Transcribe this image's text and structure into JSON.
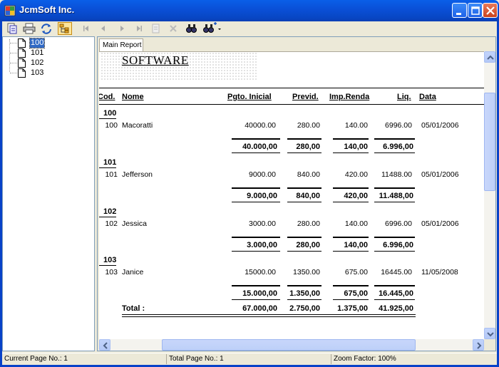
{
  "window": {
    "title": "JcmSoft Inc."
  },
  "toolbar": {
    "icons": [
      "export-icon",
      "print-icon",
      "refresh-icon",
      "group-tree-icon",
      "first-page-icon",
      "prev-page-icon",
      "next-page-icon",
      "last-page-icon",
      "goto-page-icon",
      "stop-icon",
      "search-icon",
      "zoom-icon"
    ]
  },
  "tree": {
    "items": [
      {
        "label": "100",
        "selected": true
      },
      {
        "label": "101",
        "selected": false
      },
      {
        "label": "102",
        "selected": false
      },
      {
        "label": "103",
        "selected": false
      }
    ]
  },
  "report": {
    "tab_label": "Main Report",
    "title": "SOFTWARE",
    "columns": {
      "cod": "Cod.",
      "nome": "Nome",
      "pgto": "Pgto. Inicial",
      "previd": "Previd.",
      "imp": "Imp.Renda",
      "liq": "Liq.",
      "data": "Data"
    },
    "groups": [
      {
        "group": "100",
        "row": {
          "cod": "100",
          "nome": "Macoratti",
          "pgto": "40000.00",
          "previd": "280.00",
          "imp": "140.00",
          "liq": "6996.00",
          "data": "05/01/2006"
        },
        "subtotal": {
          "pgto": "40.000,00",
          "previd": "280,00",
          "imp": "140,00",
          "liq": "6.996,00"
        }
      },
      {
        "group": "101",
        "row": {
          "cod": "101",
          "nome": "Jefferson",
          "pgto": "9000.00",
          "previd": "840.00",
          "imp": "420.00",
          "liq": "11488.00",
          "data": "05/01/2006"
        },
        "subtotal": {
          "pgto": "9.000,00",
          "previd": "840,00",
          "imp": "420,00",
          "liq": "11.488,00"
        }
      },
      {
        "group": "102",
        "row": {
          "cod": "102",
          "nome": "Jessica",
          "pgto": "3000.00",
          "previd": "280.00",
          "imp": "140.00",
          "liq": "6996.00",
          "data": "05/01/2006"
        },
        "subtotal": {
          "pgto": "3.000,00",
          "previd": "280,00",
          "imp": "140,00",
          "liq": "6.996,00"
        }
      },
      {
        "group": "103",
        "row": {
          "cod": "103",
          "nome": "Janice",
          "pgto": "15000.00",
          "previd": "1350.00",
          "imp": "675.00",
          "liq": "16445.00",
          "data": "11/05/2008"
        },
        "subtotal": {
          "pgto": "15.000,00",
          "previd": "1.350,00",
          "imp": "675,00",
          "liq": "16.445,00"
        }
      }
    ],
    "total": {
      "label": "Total :",
      "pgto": "67.000,00",
      "previd": "2.750,00",
      "imp": "1.375,00",
      "liq": "41.925,00"
    }
  },
  "status": {
    "current_page": "Current Page No.: 1",
    "total_page": "Total Page No.: 1",
    "zoom": "Zoom Factor: 100%"
  }
}
